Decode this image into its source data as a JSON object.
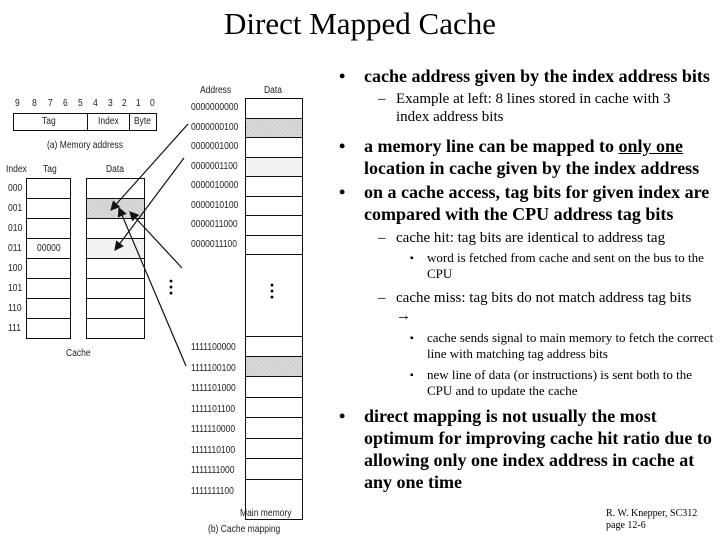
{
  "title": "Direct Mapped Cache",
  "address_format": {
    "bit_numbers": [
      "9",
      "8",
      "7",
      "6",
      "5",
      "4",
      "3",
      "2",
      "1",
      "0"
    ],
    "fields": [
      "Tag",
      "Index",
      "Byte"
    ],
    "caption": "(a) Memory address"
  },
  "cache": {
    "headers": {
      "index": "Index",
      "tag": "Tag",
      "data": "Data"
    },
    "rows": [
      {
        "index": "000",
        "tag": "",
        "state": "empty"
      },
      {
        "index": "001",
        "tag": "",
        "state": "shaded"
      },
      {
        "index": "010",
        "tag": "",
        "state": "empty"
      },
      {
        "index": "011",
        "tag": "00000",
        "state": "light"
      },
      {
        "index": "100",
        "tag": "",
        "state": "empty"
      },
      {
        "index": "101",
        "tag": "",
        "state": "empty"
      },
      {
        "index": "110",
        "tag": "",
        "state": "empty"
      },
      {
        "index": "111",
        "tag": "",
        "state": "empty"
      }
    ],
    "caption": "Cache",
    "ellipsis": "⋮"
  },
  "main_memory": {
    "headers": {
      "address": "Address",
      "data": "Data"
    },
    "top_rows": [
      {
        "address": "0000000000",
        "state": "empty"
      },
      {
        "address": "0000000100",
        "state": "shaded"
      },
      {
        "address": "0000001000",
        "state": "empty"
      },
      {
        "address": "0000001100",
        "state": "light"
      },
      {
        "address": "0000010000",
        "state": "empty"
      },
      {
        "address": "0000010100",
        "state": "empty"
      },
      {
        "address": "0000011000",
        "state": "empty"
      },
      {
        "address": "0000011100",
        "state": "empty"
      }
    ],
    "bottom_rows": [
      {
        "address": "1111100000",
        "state": "empty"
      },
      {
        "address": "1111100100",
        "state": "shaded"
      },
      {
        "address": "1111101000",
        "state": "empty"
      },
      {
        "address": "1111101100",
        "state": "empty"
      },
      {
        "address": "1111110000",
        "state": "empty"
      },
      {
        "address": "1111110100",
        "state": "empty"
      },
      {
        "address": "1111111000",
        "state": "empty"
      },
      {
        "address": "1111111100",
        "state": "empty"
      }
    ],
    "ellipsis": "⋮",
    "caption": "Main memory"
  },
  "figure_caption": "(b) Cache mapping",
  "bullets": {
    "b1": "cache address given by the index address bits",
    "b1_sub": "Example at left:  8 lines stored in cache with 3 index address bits",
    "b2_pre": "a memory line can be mapped to ",
    "b2_underline": "only one",
    "b2_post": " location in cache given by the index address",
    "b3": "on a cache access, tag bits for given index are compared with the CPU address tag bits",
    "hit": "cache hit:  tag bits are identical to address tag",
    "hit_sub": "word is fetched from cache and sent on the bus to the CPU",
    "miss": "cache miss:  tag bits do not match address tag bits →",
    "miss_sub1": "cache sends signal to main memory to fetch the correct line with matching  tag address bits",
    "miss_sub2": "new line of data (or instructions) is sent both to the CPU and to update the cache",
    "b4": "direct mapping is not usually the most optimum for improving cache hit ratio due to allowing only one index address in cache at any one time"
  },
  "markers": {
    "dot": "•",
    "dash": "–",
    "square": "▪"
  },
  "footer": {
    "line1": "R. W. Knepper, SC312",
    "line2": "page 12-6"
  }
}
